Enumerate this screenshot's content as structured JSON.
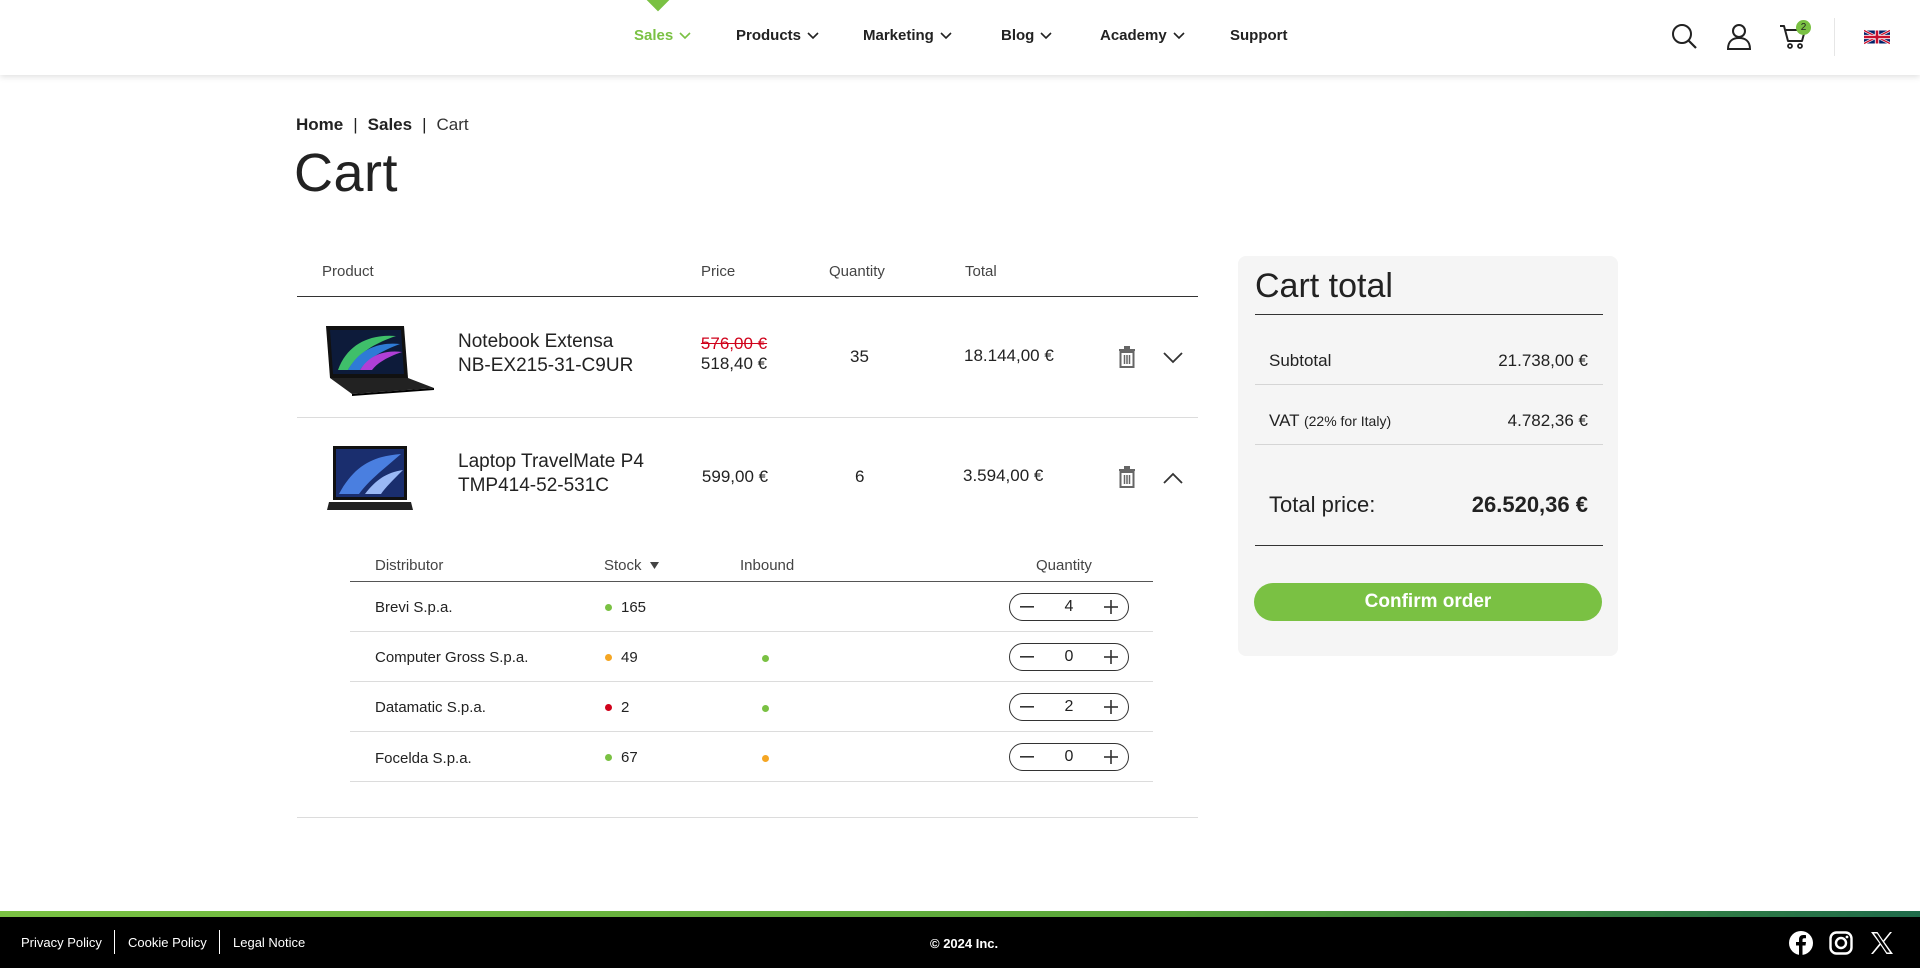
{
  "nav": {
    "items": [
      {
        "label": "Sales"
      },
      {
        "label": "Products"
      },
      {
        "label": "Marketing"
      },
      {
        "label": "Blog"
      },
      {
        "label": "Academy"
      },
      {
        "label": "Support"
      }
    ],
    "active": "Sales",
    "cart_count": "2"
  },
  "breadcrumb": {
    "home": "Home",
    "sep": "|",
    "sales": "Sales",
    "current": "Cart"
  },
  "page_title": "Cart",
  "table": {
    "headers": {
      "product": "Product",
      "price": "Price",
      "quantity": "Quantity",
      "total": "Total"
    },
    "rows": [
      {
        "name_line1": "Notebook Extensa",
        "name_line2": "NB-EX215-31-C9UR",
        "old_price": "576,00 €",
        "price": "518,40 €",
        "quantity": "35",
        "total": "18.144,00 €",
        "expanded": false
      },
      {
        "name_line1": "Laptop TravelMate P4",
        "name_line2": "TMP414-52-531C",
        "price": "599,00 €",
        "quantity": "6",
        "total": "3.594,00 €",
        "expanded": true
      }
    ]
  },
  "distributors": {
    "headers": {
      "distributor": "Distributor",
      "stock": "Stock",
      "inbound": "Inbound",
      "quantity": "Quantity"
    },
    "rows": [
      {
        "name": "Brevi S.p.a.",
        "stock": "165",
        "stock_status": "#7ac143",
        "inbound_status": null,
        "qty": "4"
      },
      {
        "name": "Computer Gross S.p.a.",
        "stock": "49",
        "stock_status": "#f5a623",
        "inbound_status": "#7ac143",
        "qty": "0"
      },
      {
        "name": "Datamatic S.p.a.",
        "stock": "2",
        "stock_status": "#d0021b",
        "inbound_status": "#7ac143",
        "qty": "2"
      },
      {
        "name": "Focelda S.p.a.",
        "stock": "67",
        "stock_status": "#7ac143",
        "inbound_status": "#f5a623",
        "qty": "0"
      }
    ]
  },
  "summary": {
    "title": "Cart total",
    "subtotal_label": "Subtotal",
    "subtotal_value": "21.738,00 €",
    "vat_label": "VAT",
    "vat_note": "(22% for Italy)",
    "vat_value": "4.782,36 €",
    "total_label": "Total price:",
    "total_value": "26.520,36 €",
    "confirm_label": "Confirm order"
  },
  "footer": {
    "privacy": "Privacy Policy",
    "cookie": "Cookie Policy",
    "legal": "Legal Notice",
    "copyright": "© 2024   Inc."
  },
  "colors": {
    "accent": "#7ac143",
    "old_price": "#d0021b",
    "footer_bg": "#000000"
  },
  "icons": [
    "search-icon",
    "user-icon",
    "cart-icon",
    "uk-flag-icon",
    "trash-icon",
    "chevron-down-icon",
    "chevron-up-icon",
    "minus-icon",
    "plus-icon",
    "facebook-icon",
    "instagram-icon",
    "x-icon",
    "sort-down-icon"
  ]
}
